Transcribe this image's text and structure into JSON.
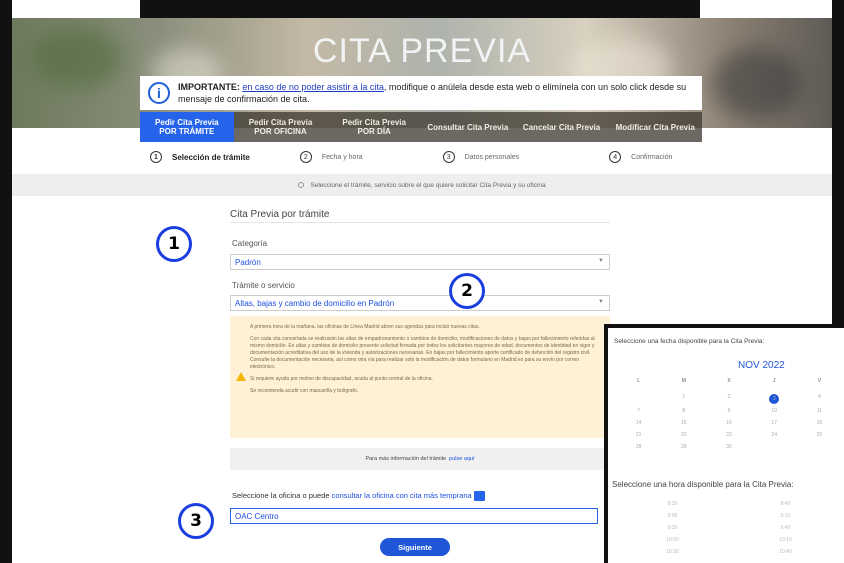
{
  "hero": {
    "title": "CITA PREVIA"
  },
  "notice": {
    "prefix": "IMPORTANTE: ",
    "link": "en caso de no poder asistir a la cita",
    "suffix": ", modifique o anúlela desde esta web o elimínela con un solo click desde su mensaje de confirmación de cita."
  },
  "tabs": [
    {
      "line1": "Pedir Cita Previa",
      "line2": "POR TRÁMITE"
    },
    {
      "line1": "Pedir Cita Previa",
      "line2": "POR OFICINA"
    },
    {
      "line1": "Pedir Cita Previa",
      "line2": "POR DÍA"
    },
    {
      "line1": "Consultar Cita Previa",
      "line2": ""
    },
    {
      "line1": "Cancelar Cita Previa",
      "line2": ""
    },
    {
      "line1": "Modificar Cita Previa",
      "line2": ""
    }
  ],
  "steps": [
    {
      "num": "1",
      "label": "Selección de trámite"
    },
    {
      "num": "2",
      "label": "Fecha y hora"
    },
    {
      "num": "3",
      "label": "Datos personales"
    },
    {
      "num": "4",
      "label": "Confirmación"
    }
  ],
  "hint": "Seleccione el trámite, servicio sobre el que quiere solicitar Cita Previa y su oficina",
  "form": {
    "section_title": "Cita Previa por trámite",
    "category_label": "Categoría",
    "category_value": "Padrón",
    "service_label": "Trámite o servicio",
    "service_value": "Altas, bajas y cambio de domicilio en Padrón"
  },
  "warning": {
    "paragraphs": [
      "A primera hora de la mañana, las oficinas de Línea Madrid abren sus agendas para incluir nuevas citas.",
      "Con cada cita concertada se realizarán las altas de empadronamiento o cambios de domicilio, modificaciones de datos y bajas por fallecimiento referidas al mismo domicilio. En altas y cambios de domicilio presente solicitud firmada por todos los solicitantes mayores de edad, documentos de identidad en vigor y documentación acreditativa del uso de la vivienda y autorizaciones necesarias. En bajas por fallecimiento aporte certificado de defunción del registro civil. Consulte la documentación necesaria, así como otra vía para realizar solo la modificación de datos formulario en Madrid.es para su envío por correo electrónico.",
      "Si requiere ayuda por motivo de discapacidad, acuda al punto central de la oficina.",
      "Se recomienda acudir con mascarilla y bolígrafo."
    ]
  },
  "more_info": {
    "text": "Para más información del trámite",
    "link": "pulse aquí"
  },
  "office": {
    "prompt": "Seleccione la oficina o puede ",
    "link": "consultar la oficina con cita más temprana",
    "value": "OAC Centro"
  },
  "next_button": "Siguiente",
  "badges": [
    "1",
    "2",
    "3"
  ],
  "calendar": {
    "date_prompt": "Seleccione una fecha disponible para la Cita Previa:",
    "month": "NOV 2022",
    "days_of_week": [
      "L",
      "M",
      "X",
      "J",
      "V"
    ],
    "weeks": [
      [
        "",
        "1",
        "2",
        "3",
        "4"
      ],
      [
        "7",
        "8",
        "9",
        "10",
        "11"
      ],
      [
        "14",
        "15",
        "16",
        "17",
        "18"
      ],
      [
        "21",
        "22",
        "23",
        "24",
        "25"
      ],
      [
        "28",
        "29",
        "30",
        "",
        ""
      ]
    ],
    "selected_day": "3",
    "hour_prompt": "Seleccione una hora disponible para la Cita Previa:",
    "hours": [
      [
        "8:30",
        "8:40"
      ],
      [
        "9:00",
        "9:10"
      ],
      [
        "9:30",
        "9:40"
      ],
      [
        "10:00",
        "10:10"
      ],
      [
        "10:30",
        "10:40"
      ]
    ]
  },
  "colors": {
    "primary": "#1f56d8",
    "warning_bg": "#fff1d6",
    "badge_border": "#1a3ee0"
  }
}
